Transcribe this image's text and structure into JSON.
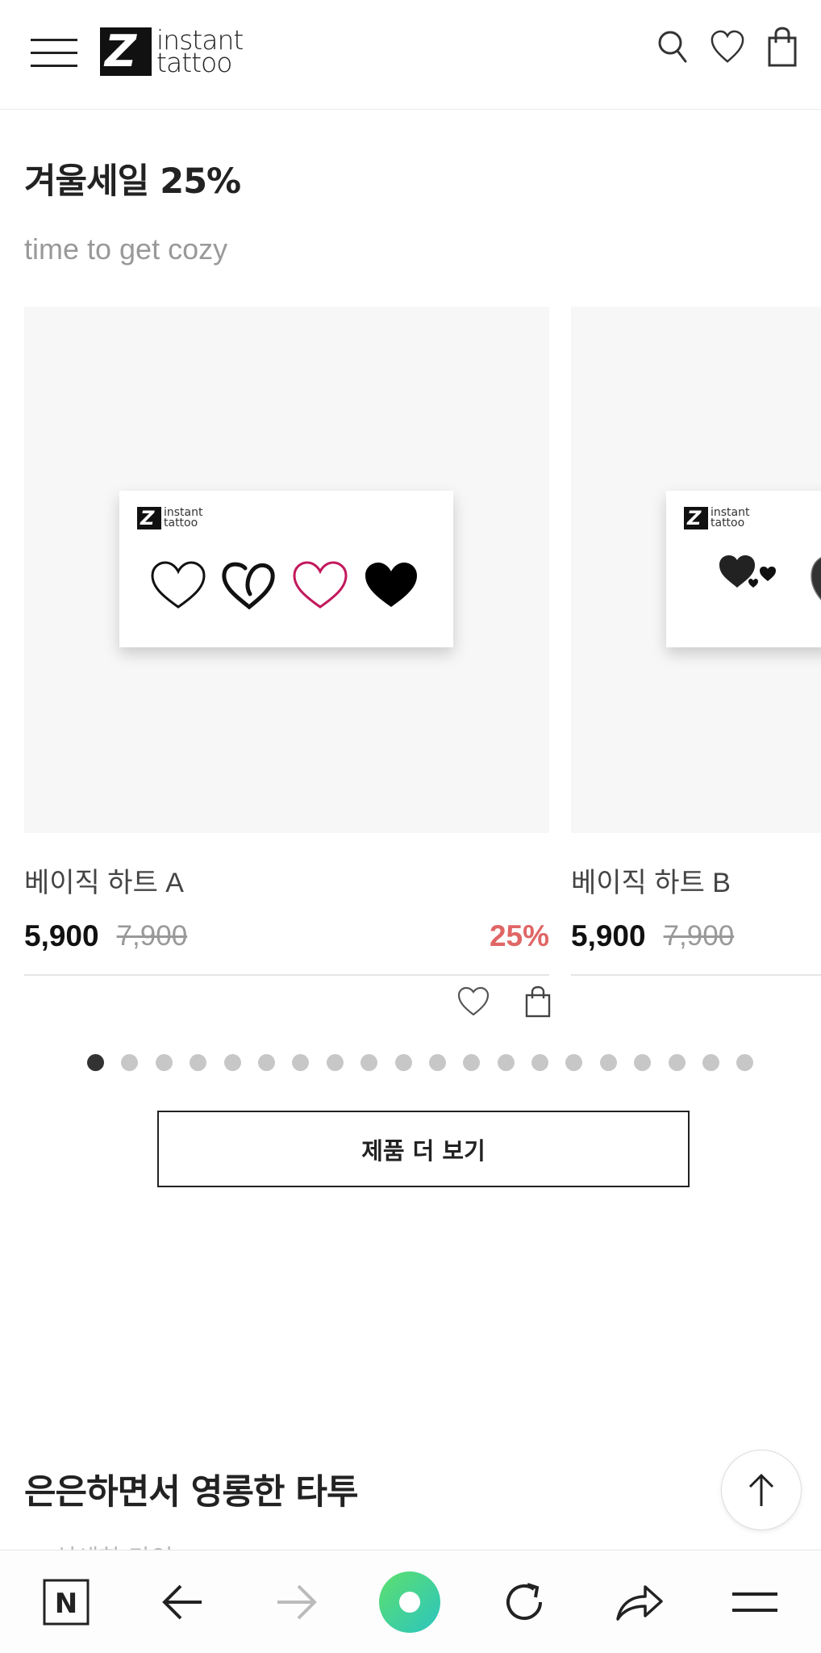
{
  "header": {
    "logo_mark": "Z",
    "logo_line1": "instant",
    "logo_line2": "tattoo"
  },
  "section1": {
    "title": "겨울세일 25%",
    "subtitle": "time to get cozy"
  },
  "products": [
    {
      "name": "베이직 하트 A",
      "price": "5,900",
      "original_price": "7,900",
      "discount": "25%"
    },
    {
      "name": "베이직 하트 B",
      "price": "5,900",
      "original_price": "7,900"
    }
  ],
  "sheet_logo": {
    "line1": "instant",
    "line2": "tattoo"
  },
  "pagination": {
    "total": 20,
    "active_index": 0
  },
  "more_button_label": "제품 더 보기",
  "section2": {
    "title": "은은하면서 영롱한 타투",
    "subtitle_partial": "ㅡ 섬세한 라인 ㅡ"
  },
  "colors": {
    "discount": "#e06666",
    "heart_pink": "#c2185b",
    "browser_green": "#3ddc84"
  },
  "icons": {
    "header": [
      "hamburger-icon",
      "search-icon",
      "heart-icon",
      "shopping-bag-icon"
    ],
    "card": [
      "heart-icon",
      "shopping-bag-icon"
    ],
    "browser": [
      "naver-icon",
      "back-arrow-icon",
      "forward-arrow-icon",
      "home-green-icon",
      "refresh-icon",
      "share-icon",
      "menu-icon"
    ]
  }
}
